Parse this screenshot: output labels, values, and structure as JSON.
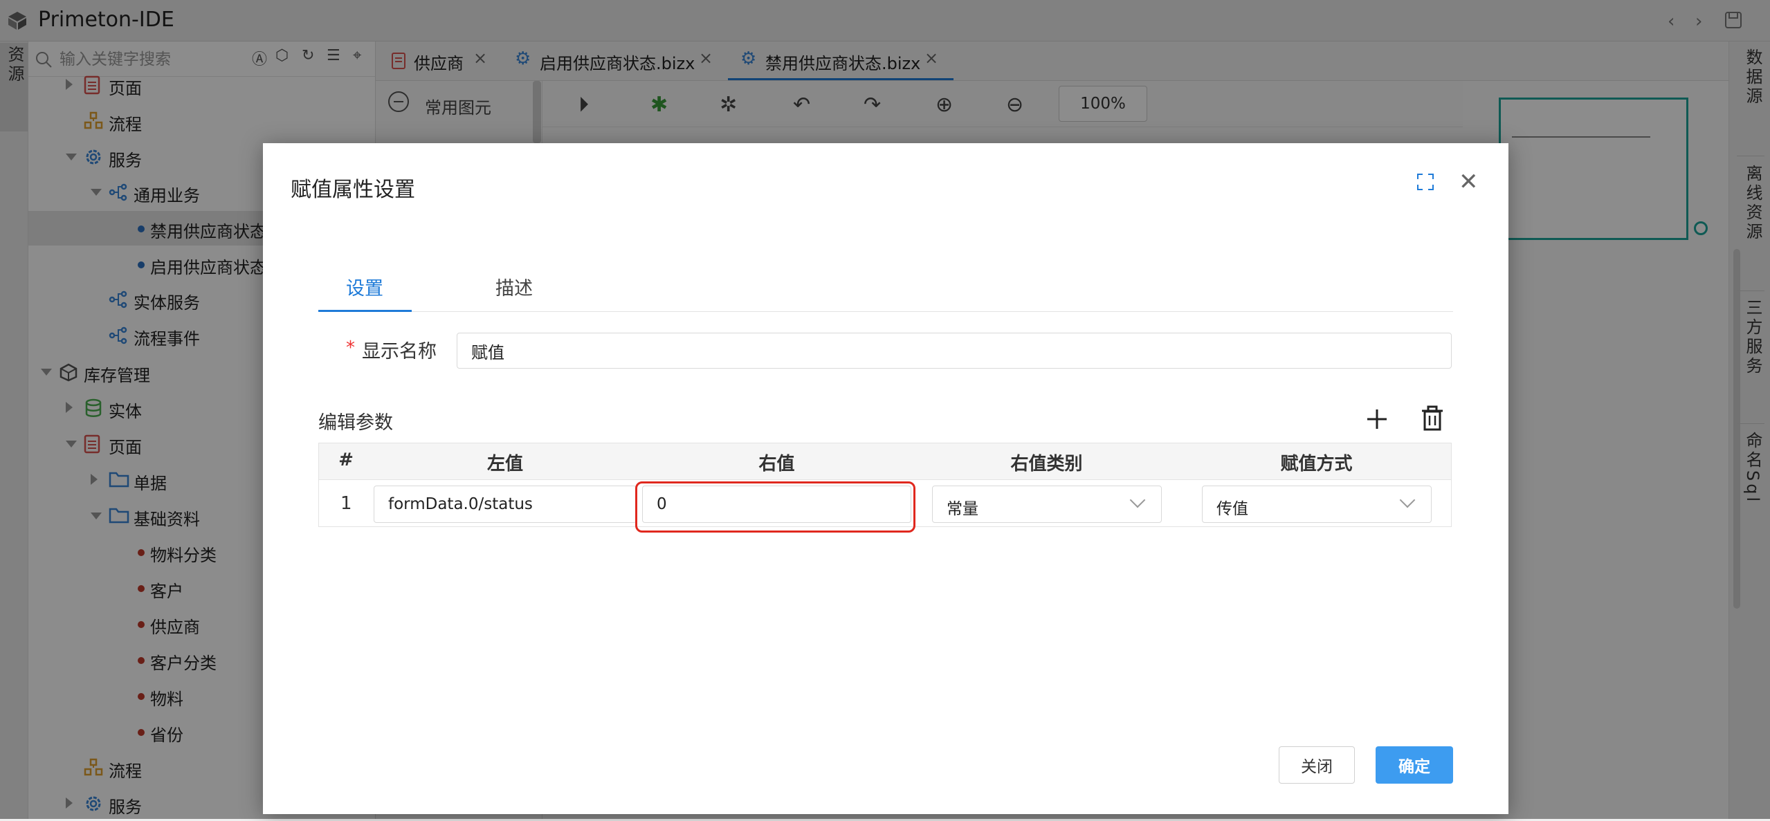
{
  "app": {
    "title": "Primeton-IDE"
  },
  "left_rail": {
    "label": "资源"
  },
  "tree_search": {
    "placeholder": "输入关键字搜索"
  },
  "tree": [
    {
      "label": "页面",
      "icon": "page-icon",
      "color": "#d9534f"
    },
    {
      "label": "流程",
      "icon": "flow-icon",
      "color": "#e0a030"
    },
    {
      "label": "服务",
      "icon": "gear-icon",
      "color": "#3a86d8"
    },
    {
      "label": "通用业务",
      "icon": "biz-tree-icon",
      "color": "#3a86d8"
    },
    {
      "label": "禁用供应商状态",
      "icon": "dot",
      "color": "#2c6fbf"
    },
    {
      "label": "启用供应商状态",
      "icon": "dot",
      "color": "#2c6fbf"
    },
    {
      "label": "实体服务",
      "icon": "biz-tree-icon",
      "color": "#3a86d8"
    },
    {
      "label": "流程事件",
      "icon": "biz-tree-icon",
      "color": "#3a86d8"
    },
    {
      "label": "库存管理",
      "icon": "cube-icon",
      "color": "#555555"
    },
    {
      "label": "实体",
      "icon": "database-icon",
      "color": "#4caf50"
    },
    {
      "label": "页面",
      "icon": "page-icon",
      "color": "#d9534f"
    },
    {
      "label": "单据",
      "icon": "folder-icon",
      "color": "#3a86d8"
    },
    {
      "label": "基础资料",
      "icon": "folder-icon",
      "color": "#3a86d8"
    },
    {
      "label": "物料分类",
      "icon": "dot",
      "color": "#c0392b"
    },
    {
      "label": "客户",
      "icon": "dot",
      "color": "#c0392b"
    },
    {
      "label": "供应商",
      "icon": "dot",
      "color": "#c0392b"
    },
    {
      "label": "客户分类",
      "icon": "dot",
      "color": "#c0392b"
    },
    {
      "label": "物料",
      "icon": "dot",
      "color": "#c0392b"
    },
    {
      "label": "省份",
      "icon": "dot",
      "color": "#c0392b"
    },
    {
      "label": "流程",
      "icon": "flow-icon",
      "color": "#e0a030"
    },
    {
      "label": "服务",
      "icon": "gear-icon",
      "color": "#3a86d8"
    }
  ],
  "editor_tabs": [
    {
      "label": "供应商",
      "icon": "page-icon"
    },
    {
      "label": "启用供应商状态.bizx",
      "icon": "gear-icon"
    },
    {
      "label": "禁用供应商状态.bizx",
      "icon": "gear-icon",
      "active": true
    }
  ],
  "palette": {
    "title": "常用图元"
  },
  "canvas_toolbar": {
    "zoom": "100%"
  },
  "right_rail": [
    "数据源",
    "离线资源",
    "三方服务",
    "命名Sql"
  ],
  "dialog": {
    "title": "赋值属性设置",
    "tabs": [
      {
        "label": "设置",
        "active": true
      },
      {
        "label": "描述"
      }
    ],
    "display_name_label": "显示名称",
    "required_mark": "*",
    "display_name_value": "赋值",
    "params_label": "编辑参数",
    "grid": {
      "columns": [
        "#",
        "左值",
        "右值",
        "右值类别",
        "赋值方式"
      ],
      "rows": [
        {
          "num": "1",
          "left": "formData.0/status",
          "right": "0",
          "right_type": "常量",
          "assign_mode": "传值"
        }
      ]
    },
    "buttons": {
      "close": "关闭",
      "ok": "确定"
    }
  },
  "colors": {
    "accent": "#1f7bd8",
    "primary_button": "#3d9cf0",
    "highlight": "#e0281e",
    "minimap": "#1ca59a"
  }
}
